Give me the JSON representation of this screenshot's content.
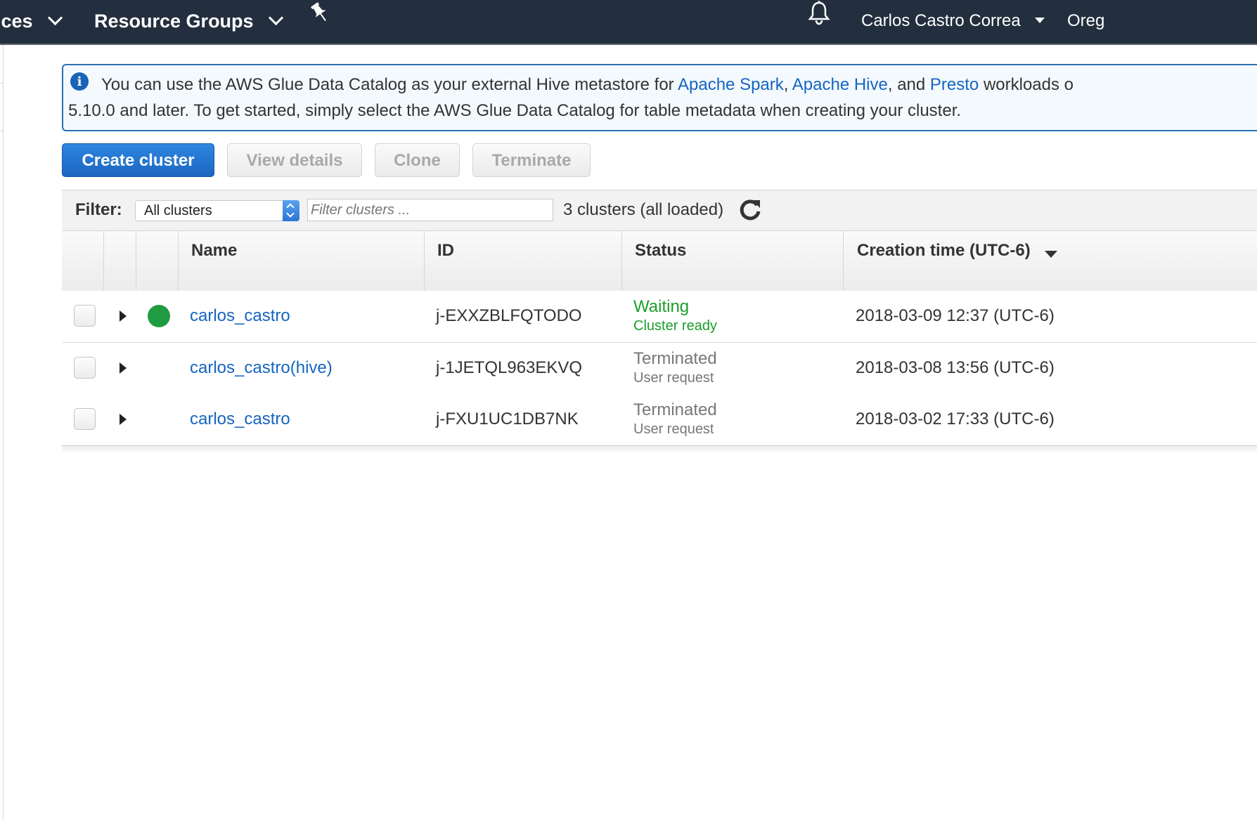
{
  "topbar": {
    "services_label": "ices",
    "resource_groups_label": "Resource Groups",
    "user_name": "Carlos Castro Correa",
    "region_label": "Oreg"
  },
  "banner": {
    "text_before": "You can use the AWS Glue Data Catalog as your external Hive metastore for ",
    "link_spark": "Apache Spark",
    "sep1": ", ",
    "link_hive": "Apache Hive",
    "sep2": ", and ",
    "link_presto": "Presto",
    "text_after": " workloads o",
    "line2": "5.10.0 and later. To get started, simply select the AWS Glue Data Catalog for table metadata when creating your cluster."
  },
  "toolbar": {
    "create_label": "Create cluster",
    "view_label": "View details",
    "clone_label": "Clone",
    "terminate_label": "Terminate"
  },
  "filter": {
    "label": "Filter:",
    "selected": "All clusters",
    "placeholder": "Filter clusters ...",
    "count_text": "3 clusters (all loaded)"
  },
  "table": {
    "headers": {
      "name": "Name",
      "id": "ID",
      "status": "Status",
      "creation": "Creation time (UTC-6)"
    },
    "rows": [
      {
        "name": "carlos_castro",
        "id": "j-EXXZBLFQTODO",
        "status": "Waiting",
        "status_detail": "Cluster ready",
        "created": "2018-03-09 12:37 (UTC-6)"
      },
      {
        "name": "carlos_castro(hive)",
        "id": "j-1JETQL963EKVQ",
        "status": "Terminated",
        "status_detail": "User request",
        "created": "2018-03-08 13:56 (UTC-6)"
      },
      {
        "name": "carlos_castro",
        "id": "j-FXU1UC1DB7NK",
        "status": "Terminated",
        "status_detail": "User request",
        "created": "2018-03-02 17:33 (UTC-6)"
      }
    ]
  },
  "colors": {
    "topbar": "#232f3e",
    "link": "#1565c0",
    "primary_button": "#1b66c1",
    "status_waiting": "#1b9e2b",
    "status_running_dot": "#1f9c41",
    "status_terminated": "#777777"
  },
  "icons": [
    "chevron-down-icon",
    "pin-icon",
    "bell-icon",
    "info-icon",
    "select-arrows-icon",
    "refresh-icon",
    "sort-desc-icon",
    "expand-triangle-icon",
    "status-dot-icon"
  ]
}
